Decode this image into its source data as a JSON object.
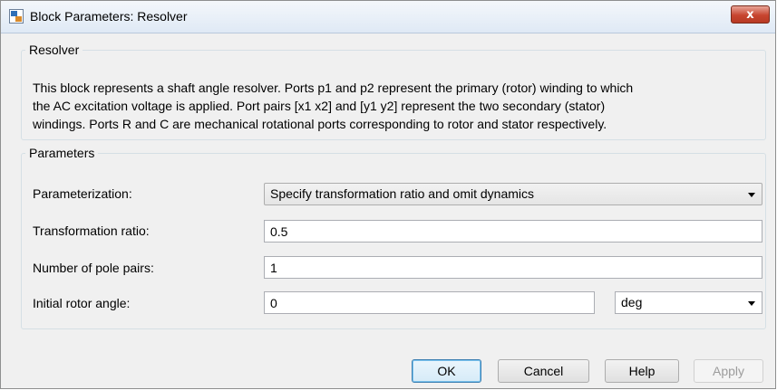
{
  "window": {
    "title": "Block Parameters: Resolver",
    "close_symbol": "x"
  },
  "description_group": {
    "legend": "Resolver",
    "lines": [
      "This block represents a shaft angle resolver. Ports p1 and p2 represent the primary (rotor) winding to which",
      "the AC excitation voltage is applied. Port pairs [x1 x2] and [y1 y2] represent the two secondary (stator)",
      "windings. Ports R and C are mechanical rotational ports corresponding to rotor and stator respectively."
    ]
  },
  "parameters_group": {
    "legend": "Parameters",
    "parameterization": {
      "label": "Parameterization:",
      "value": "Specify transformation ratio and omit dynamics"
    },
    "transformation_ratio": {
      "label": "Transformation ratio:",
      "value": "0.5"
    },
    "pole_pairs": {
      "label": "Number of pole pairs:",
      "value": "1"
    },
    "initial_rotor_angle": {
      "label": "Initial rotor angle:",
      "value": "0",
      "unit": "deg"
    }
  },
  "buttons": {
    "ok": "OK",
    "cancel": "Cancel",
    "help": "Help",
    "apply": "Apply"
  },
  "icons": {
    "app": "block-parameters-icon",
    "close": "close-icon",
    "dropdown": "chevron-down-icon"
  }
}
